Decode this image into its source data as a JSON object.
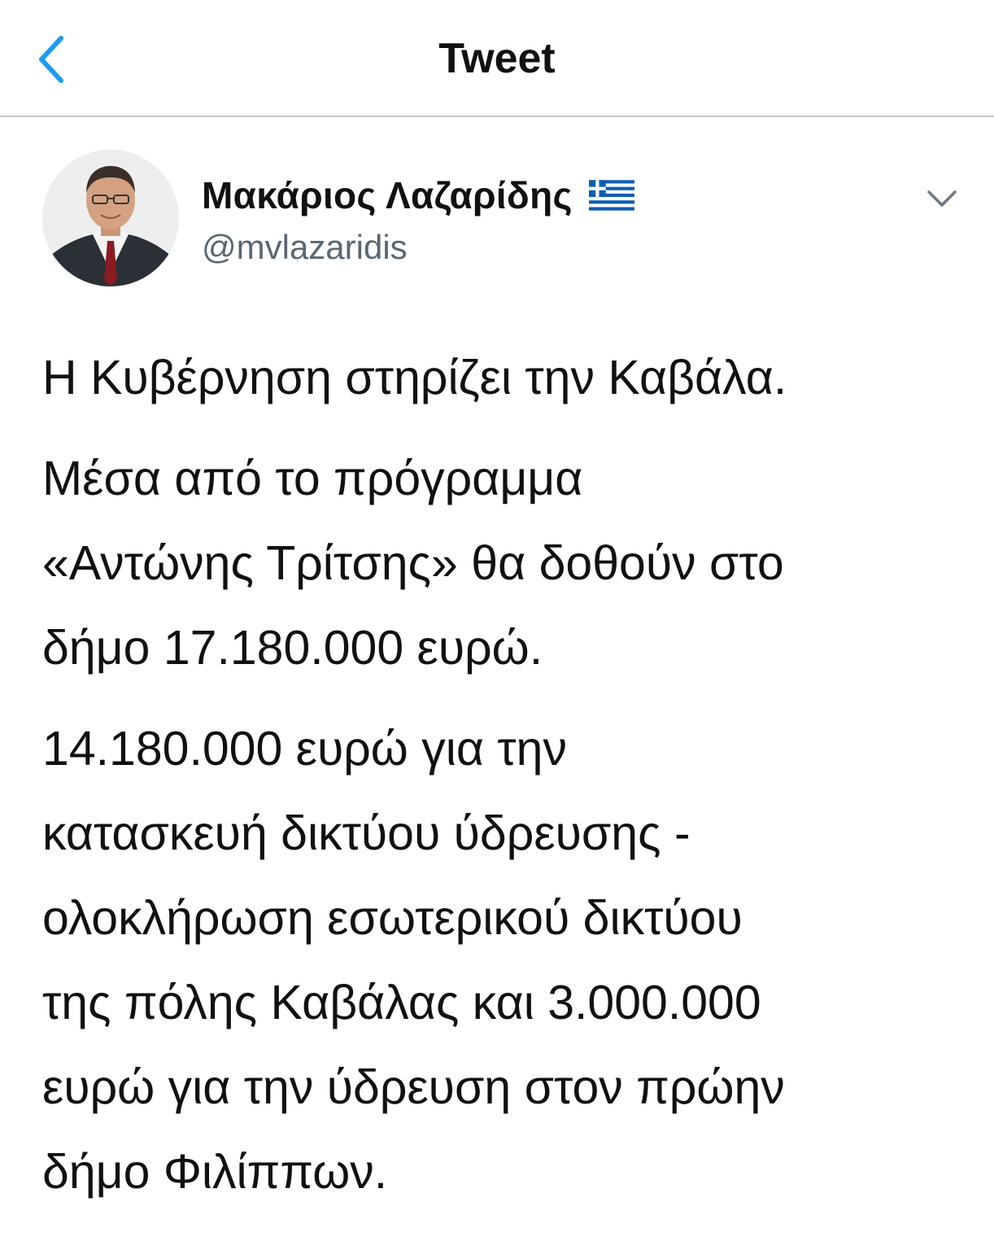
{
  "nav": {
    "title": "Tweet",
    "back_icon": "chevron-left-icon",
    "accent_color": "#1d9bf0"
  },
  "author": {
    "display_name": "Μακάριος Λαζαρίδης",
    "handle": "@mvlazaridis",
    "flag_icon": "greek-flag-icon",
    "more_icon": "chevron-down-icon"
  },
  "tweet": {
    "paragraphs": [
      [
        "Η Κυβέρνηση στηρίζει την Καβάλα."
      ],
      [
        "Μέσα από το πρόγραμμα",
        "«Αντώνης Τρίτσης» θα δοθούν στο",
        "δήμο 17.180.000 ευρώ."
      ],
      [
        "14.180.000 ευρώ για την",
        "κατασκευή δικτύου ύδρευσης -",
        "ολοκλήρωση εσωτερικού δικτύου",
        "της πόλης Καβάλας και 3.000.000",
        "ευρώ για την ύδρευση στον πρώην",
        "δήμο Φιλίππων."
      ]
    ]
  }
}
